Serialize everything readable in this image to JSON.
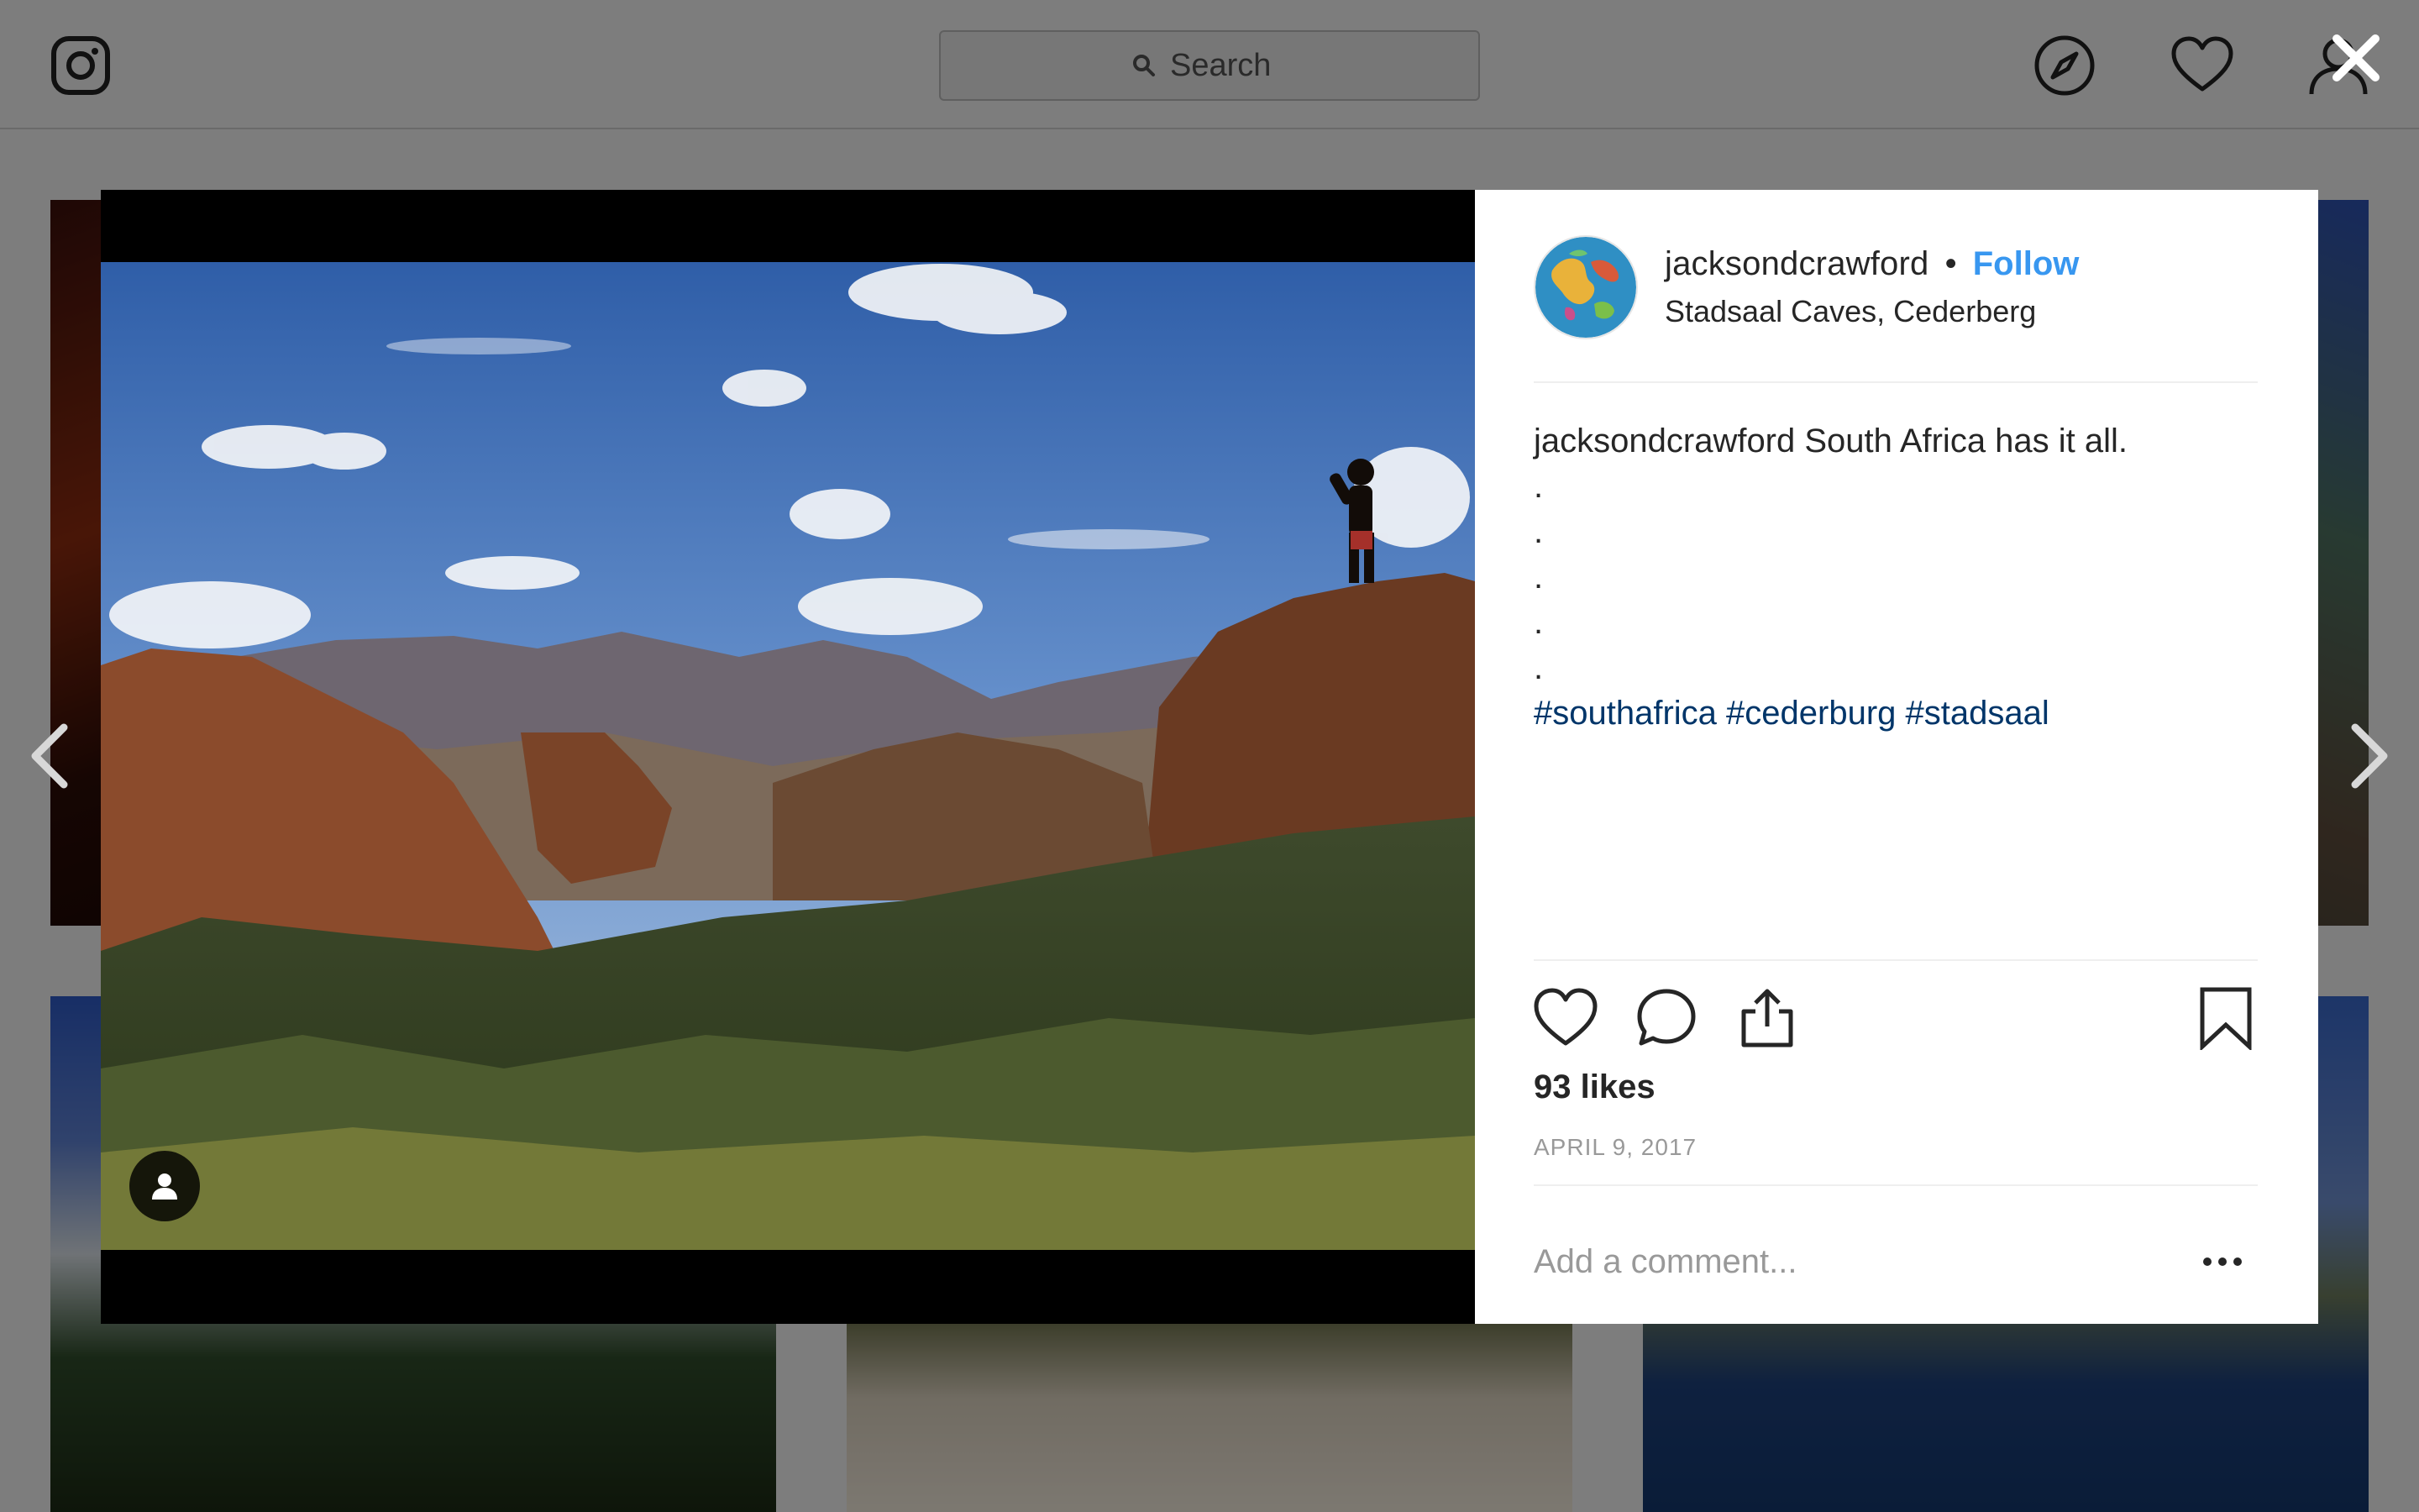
{
  "topbar": {
    "search_placeholder": "Search",
    "icons": [
      "instagram-logo-icon",
      "search-icon",
      "compass-icon",
      "heart-icon",
      "profile-icon",
      "close-icon"
    ]
  },
  "post": {
    "username": "jacksondcrawford",
    "separator": "•",
    "follow_label": "Follow",
    "location": "Stadsaal Caves, Cederberg",
    "caption_text": "South Africa has it all.",
    "caption_dots": [
      ".",
      ".",
      ".",
      ".",
      "."
    ],
    "hashtags": [
      "#southafrica",
      "#cederburg",
      "#stadsaal"
    ],
    "likes": "93 likes",
    "date": "APRIL 9, 2017",
    "comment_placeholder": "Add a comment...",
    "icons": [
      "like-heart-icon",
      "comment-bubble-icon",
      "share-icon",
      "bookmark-icon",
      "more-options-icon",
      "tag-user-icon"
    ]
  },
  "colors": {
    "follow_blue": "#3897f0",
    "hashtag_navy": "#003569",
    "overlay_gray": "#7d7d7d",
    "muted_text": "#999999"
  }
}
